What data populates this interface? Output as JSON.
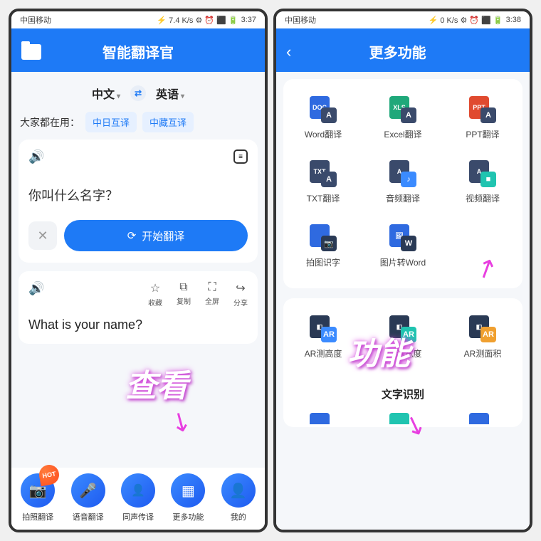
{
  "screen1": {
    "status": {
      "carrier": "中国移动",
      "time": "3:37",
      "extra": "⚡ 7.4 K/s ⚙ ⏰ ⬛ 🔋"
    },
    "header_title": "智能翻译官",
    "lang": {
      "from": "中文",
      "to": "英语"
    },
    "popular_label": "大家都在用：",
    "chips": [
      "中日互译",
      "中藏互译"
    ],
    "input_text": "你叫什么名字？",
    "translate_label": "开始翻译",
    "result_actions": [
      {
        "icon": "☆",
        "label": "收藏"
      },
      {
        "icon": "⧉",
        "label": "复制"
      },
      {
        "icon": "⛶",
        "label": "全屏"
      },
      {
        "icon": "↪",
        "label": "分享"
      }
    ],
    "result_text": "What is your name?",
    "nav": [
      {
        "icon": "📷",
        "label": "拍照翻译",
        "hot": true
      },
      {
        "icon": "🎤",
        "label": "语音翻译"
      },
      {
        "icon": "👤🔊",
        "label": "同声传译"
      },
      {
        "icon": "▦",
        "label": "更多功能"
      },
      {
        "icon": "👤",
        "label": "我的"
      }
    ],
    "annotation": "查看"
  },
  "screen2": {
    "status": {
      "carrier": "中国移动",
      "time": "3:38",
      "extra": "⚡ 0 K/s ⚙ ⏰ ⬛ 🔋"
    },
    "header_title": "更多功能",
    "tiles_a": [
      {
        "tag": "DOC",
        "color": "#2f6ae0",
        "sub": "A",
        "subbg": "#3a4a6b",
        "label": "Word翻译"
      },
      {
        "tag": "XLS",
        "color": "#1fa87a",
        "sub": "A",
        "subbg": "#3a4a6b",
        "label": "Excel翻译"
      },
      {
        "tag": "PPT",
        "color": "#e04a2f",
        "sub": "A",
        "subbg": "#3a4a6b",
        "label": "PPT翻译"
      },
      {
        "tag": "TXT",
        "color": "#3a4a6b",
        "sub": "A",
        "subbg": "#3a4a6b",
        "label": "TXT翻译"
      },
      {
        "tag": "A",
        "color": "#3a4a6b",
        "sub": "♪",
        "subbg": "#3b8bff",
        "label": "音频翻译"
      },
      {
        "tag": "A",
        "color": "#3a4a6b",
        "sub": "■",
        "subbg": "#20c4b0",
        "label": "视频翻译"
      },
      {
        "tag": "",
        "color": "#2f6ae0",
        "sub": "📷",
        "subbg": "#2a3a55",
        "label": "拍图识字"
      },
      {
        "tag": "🖼",
        "color": "#2f6ae0",
        "sub": "W",
        "subbg": "#2a3a55",
        "label": "图片转Word"
      }
    ],
    "tiles_b": [
      {
        "tag": "◧",
        "color": "#2a3a55",
        "sub": "AR",
        "subbg": "#3b8bff",
        "label": "AR测高度"
      },
      {
        "tag": "◧",
        "color": "#2a3a55",
        "sub": "AR",
        "subbg": "#20c4b0",
        "label": "AR测宽度"
      },
      {
        "tag": "◧",
        "color": "#2a3a55",
        "sub": "AR",
        "subbg": "#f0a030",
        "label": "AR测面积"
      }
    ],
    "section_title": "文字识别",
    "annotation": "功能"
  }
}
